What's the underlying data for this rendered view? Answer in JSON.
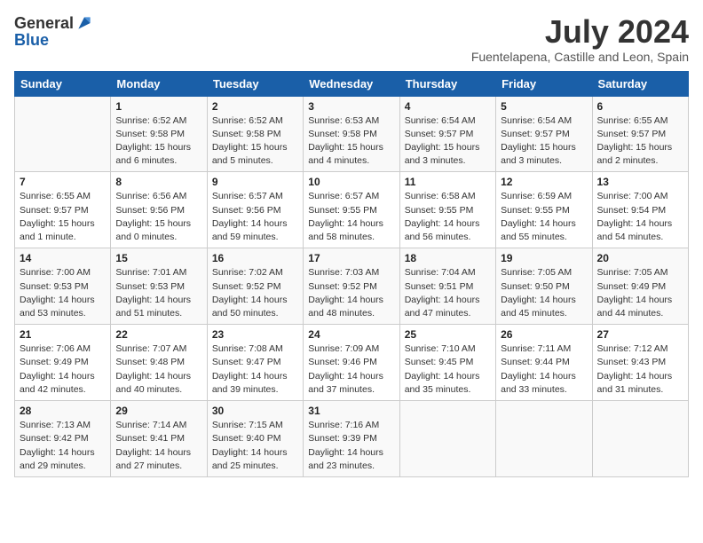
{
  "header": {
    "logo_general": "General",
    "logo_blue": "Blue",
    "month_title": "July 2024",
    "location": "Fuentelapena, Castille and Leon, Spain"
  },
  "weekdays": [
    "Sunday",
    "Monday",
    "Tuesday",
    "Wednesday",
    "Thursday",
    "Friday",
    "Saturday"
  ],
  "weeks": [
    [
      {
        "day": "",
        "sunrise": "",
        "sunset": "",
        "daylight": ""
      },
      {
        "day": "1",
        "sunrise": "Sunrise: 6:52 AM",
        "sunset": "Sunset: 9:58 PM",
        "daylight": "Daylight: 15 hours and 6 minutes."
      },
      {
        "day": "2",
        "sunrise": "Sunrise: 6:52 AM",
        "sunset": "Sunset: 9:58 PM",
        "daylight": "Daylight: 15 hours and 5 minutes."
      },
      {
        "day": "3",
        "sunrise": "Sunrise: 6:53 AM",
        "sunset": "Sunset: 9:58 PM",
        "daylight": "Daylight: 15 hours and 4 minutes."
      },
      {
        "day": "4",
        "sunrise": "Sunrise: 6:54 AM",
        "sunset": "Sunset: 9:57 PM",
        "daylight": "Daylight: 15 hours and 3 minutes."
      },
      {
        "day": "5",
        "sunrise": "Sunrise: 6:54 AM",
        "sunset": "Sunset: 9:57 PM",
        "daylight": "Daylight: 15 hours and 3 minutes."
      },
      {
        "day": "6",
        "sunrise": "Sunrise: 6:55 AM",
        "sunset": "Sunset: 9:57 PM",
        "daylight": "Daylight: 15 hours and 2 minutes."
      }
    ],
    [
      {
        "day": "7",
        "sunrise": "Sunrise: 6:55 AM",
        "sunset": "Sunset: 9:57 PM",
        "daylight": "Daylight: 15 hours and 1 minute."
      },
      {
        "day": "8",
        "sunrise": "Sunrise: 6:56 AM",
        "sunset": "Sunset: 9:56 PM",
        "daylight": "Daylight: 15 hours and 0 minutes."
      },
      {
        "day": "9",
        "sunrise": "Sunrise: 6:57 AM",
        "sunset": "Sunset: 9:56 PM",
        "daylight": "Daylight: 14 hours and 59 minutes."
      },
      {
        "day": "10",
        "sunrise": "Sunrise: 6:57 AM",
        "sunset": "Sunset: 9:55 PM",
        "daylight": "Daylight: 14 hours and 58 minutes."
      },
      {
        "day": "11",
        "sunrise": "Sunrise: 6:58 AM",
        "sunset": "Sunset: 9:55 PM",
        "daylight": "Daylight: 14 hours and 56 minutes."
      },
      {
        "day": "12",
        "sunrise": "Sunrise: 6:59 AM",
        "sunset": "Sunset: 9:55 PM",
        "daylight": "Daylight: 14 hours and 55 minutes."
      },
      {
        "day": "13",
        "sunrise": "Sunrise: 7:00 AM",
        "sunset": "Sunset: 9:54 PM",
        "daylight": "Daylight: 14 hours and 54 minutes."
      }
    ],
    [
      {
        "day": "14",
        "sunrise": "Sunrise: 7:00 AM",
        "sunset": "Sunset: 9:53 PM",
        "daylight": "Daylight: 14 hours and 53 minutes."
      },
      {
        "day": "15",
        "sunrise": "Sunrise: 7:01 AM",
        "sunset": "Sunset: 9:53 PM",
        "daylight": "Daylight: 14 hours and 51 minutes."
      },
      {
        "day": "16",
        "sunrise": "Sunrise: 7:02 AM",
        "sunset": "Sunset: 9:52 PM",
        "daylight": "Daylight: 14 hours and 50 minutes."
      },
      {
        "day": "17",
        "sunrise": "Sunrise: 7:03 AM",
        "sunset": "Sunset: 9:52 PM",
        "daylight": "Daylight: 14 hours and 48 minutes."
      },
      {
        "day": "18",
        "sunrise": "Sunrise: 7:04 AM",
        "sunset": "Sunset: 9:51 PM",
        "daylight": "Daylight: 14 hours and 47 minutes."
      },
      {
        "day": "19",
        "sunrise": "Sunrise: 7:05 AM",
        "sunset": "Sunset: 9:50 PM",
        "daylight": "Daylight: 14 hours and 45 minutes."
      },
      {
        "day": "20",
        "sunrise": "Sunrise: 7:05 AM",
        "sunset": "Sunset: 9:49 PM",
        "daylight": "Daylight: 14 hours and 44 minutes."
      }
    ],
    [
      {
        "day": "21",
        "sunrise": "Sunrise: 7:06 AM",
        "sunset": "Sunset: 9:49 PM",
        "daylight": "Daylight: 14 hours and 42 minutes."
      },
      {
        "day": "22",
        "sunrise": "Sunrise: 7:07 AM",
        "sunset": "Sunset: 9:48 PM",
        "daylight": "Daylight: 14 hours and 40 minutes."
      },
      {
        "day": "23",
        "sunrise": "Sunrise: 7:08 AM",
        "sunset": "Sunset: 9:47 PM",
        "daylight": "Daylight: 14 hours and 39 minutes."
      },
      {
        "day": "24",
        "sunrise": "Sunrise: 7:09 AM",
        "sunset": "Sunset: 9:46 PM",
        "daylight": "Daylight: 14 hours and 37 minutes."
      },
      {
        "day": "25",
        "sunrise": "Sunrise: 7:10 AM",
        "sunset": "Sunset: 9:45 PM",
        "daylight": "Daylight: 14 hours and 35 minutes."
      },
      {
        "day": "26",
        "sunrise": "Sunrise: 7:11 AM",
        "sunset": "Sunset: 9:44 PM",
        "daylight": "Daylight: 14 hours and 33 minutes."
      },
      {
        "day": "27",
        "sunrise": "Sunrise: 7:12 AM",
        "sunset": "Sunset: 9:43 PM",
        "daylight": "Daylight: 14 hours and 31 minutes."
      }
    ],
    [
      {
        "day": "28",
        "sunrise": "Sunrise: 7:13 AM",
        "sunset": "Sunset: 9:42 PM",
        "daylight": "Daylight: 14 hours and 29 minutes."
      },
      {
        "day": "29",
        "sunrise": "Sunrise: 7:14 AM",
        "sunset": "Sunset: 9:41 PM",
        "daylight": "Daylight: 14 hours and 27 minutes."
      },
      {
        "day": "30",
        "sunrise": "Sunrise: 7:15 AM",
        "sunset": "Sunset: 9:40 PM",
        "daylight": "Daylight: 14 hours and 25 minutes."
      },
      {
        "day": "31",
        "sunrise": "Sunrise: 7:16 AM",
        "sunset": "Sunset: 9:39 PM",
        "daylight": "Daylight: 14 hours and 23 minutes."
      },
      {
        "day": "",
        "sunrise": "",
        "sunset": "",
        "daylight": ""
      },
      {
        "day": "",
        "sunrise": "",
        "sunset": "",
        "daylight": ""
      },
      {
        "day": "",
        "sunrise": "",
        "sunset": "",
        "daylight": ""
      }
    ]
  ]
}
